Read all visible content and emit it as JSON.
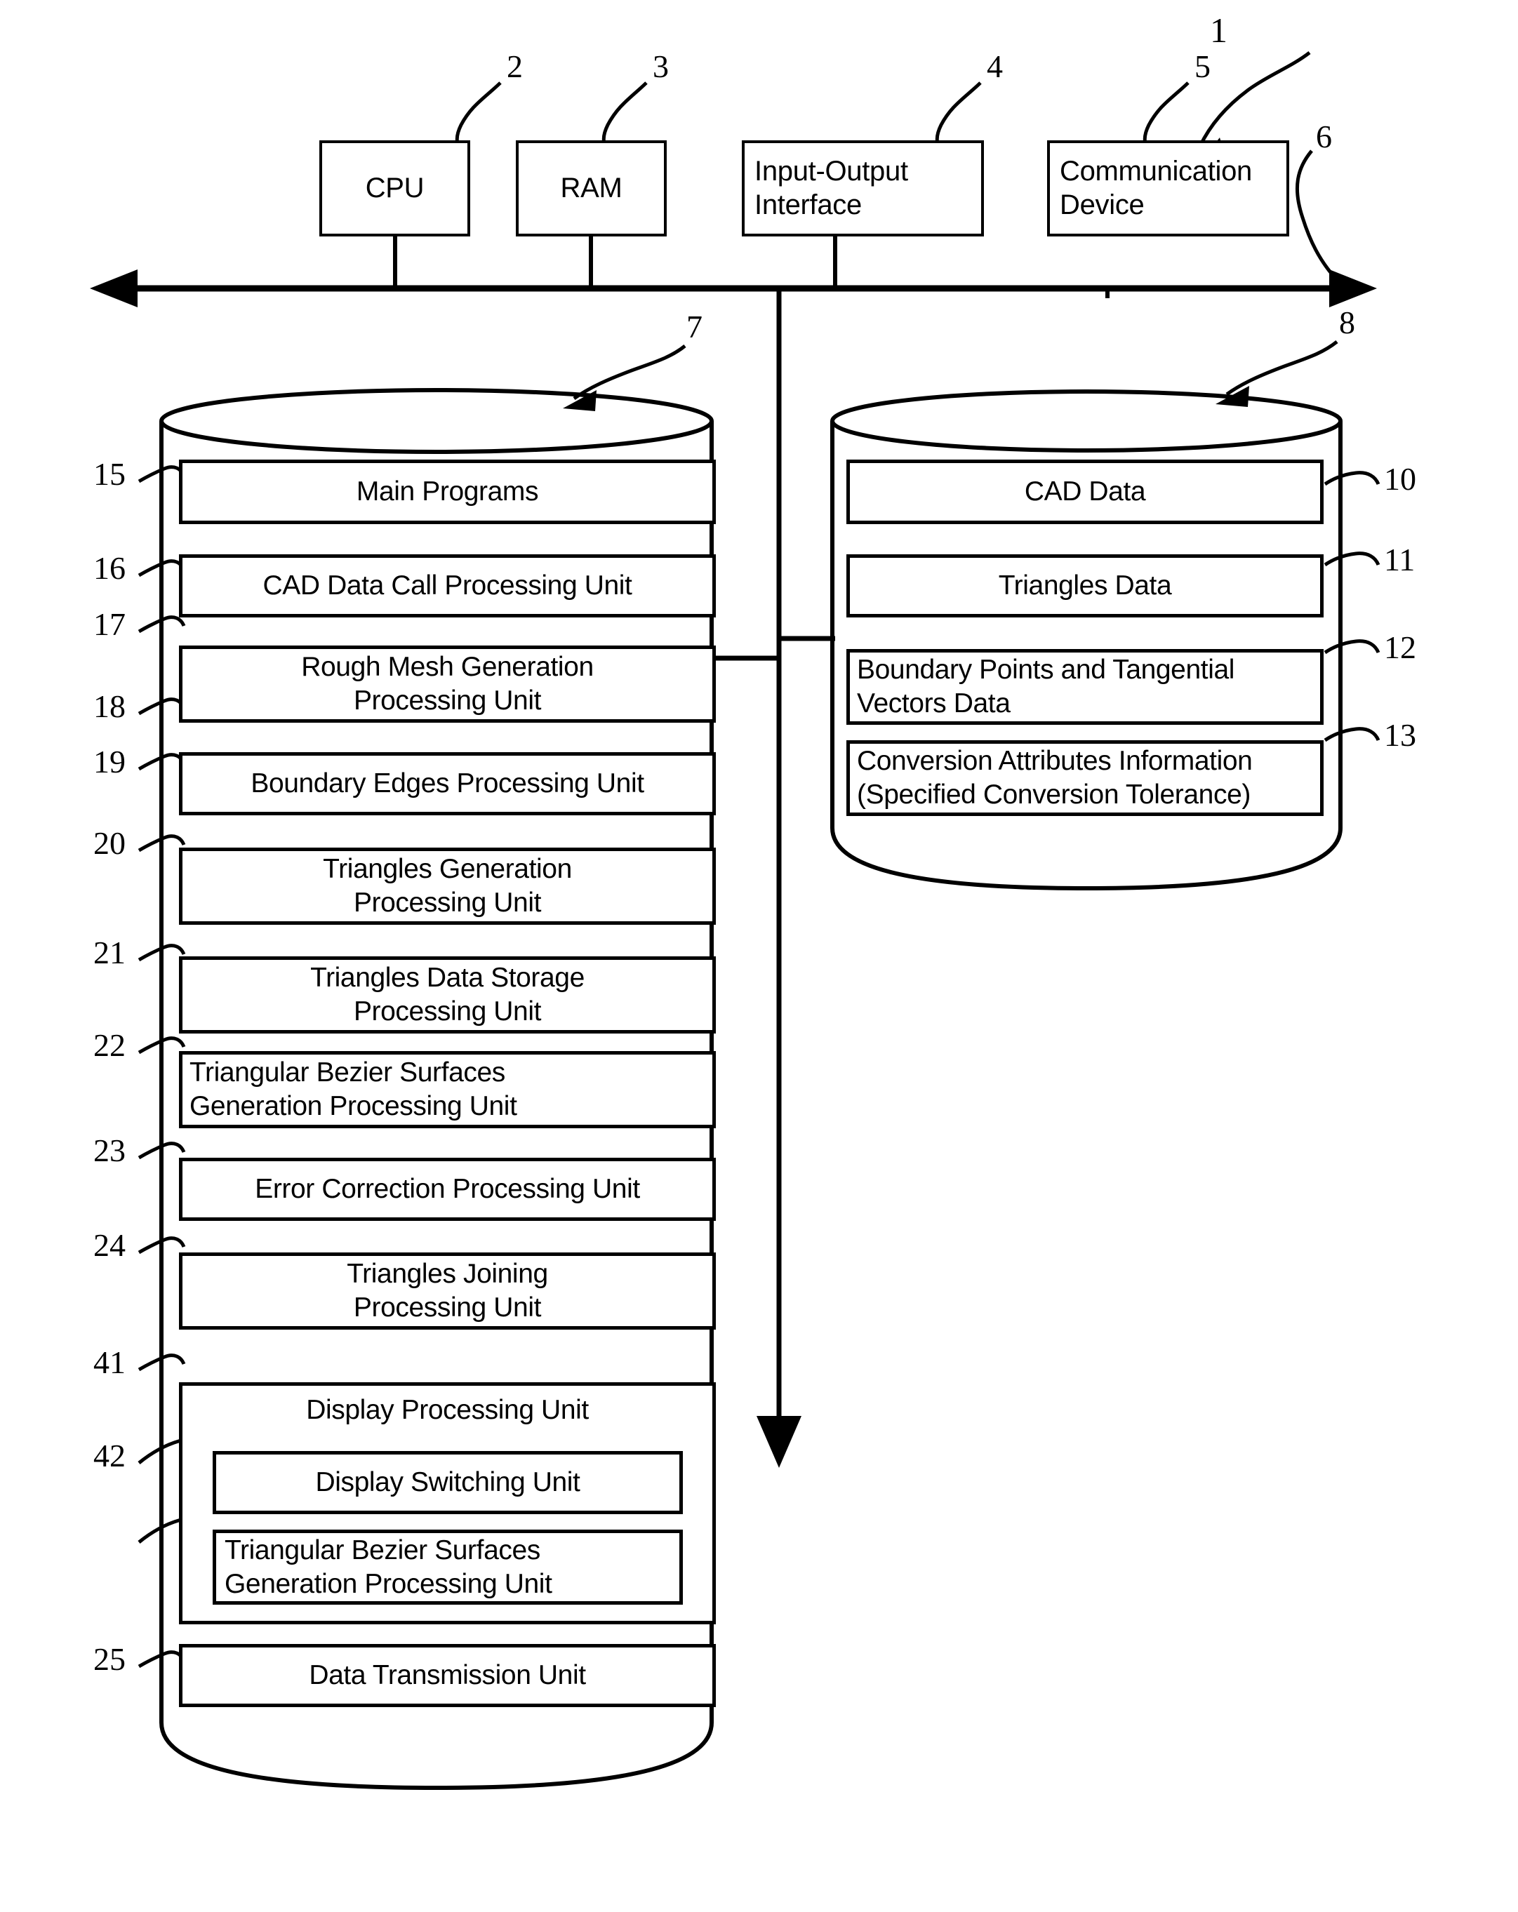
{
  "figure": {
    "type": "patent-block-diagram",
    "system_ref": "1",
    "bus_ref": "6",
    "program_storage_ref": "7",
    "data_storage_ref": "8"
  },
  "hardware": {
    "boxes": [
      {
        "ref": "2",
        "label": "CPU"
      },
      {
        "ref": "3",
        "label": "RAM"
      },
      {
        "ref": "4",
        "label_line1": "Input-Output",
        "label_line2": "Interface"
      },
      {
        "ref": "5",
        "label_line1": "Communication",
        "label_line2": "Device"
      }
    ]
  },
  "program_storage": {
    "ref": "7",
    "units": [
      {
        "ref": "15",
        "line1": "Main Programs",
        "line2": ""
      },
      {
        "ref": "16",
        "line1": "CAD Data Call Processing Unit",
        "line2": ""
      },
      {
        "ref": "17",
        "line1": "Rough Mesh Generation",
        "line2": "Processing Unit"
      },
      {
        "ref": "18",
        "line1": "Boundary Edges Processing Unit",
        "line2": ""
      },
      {
        "ref": "19",
        "line1": "Triangles Generation",
        "line2": "Processing Unit"
      },
      {
        "ref": "20",
        "line1": "Triangles Data Storage",
        "line2": "Processing Unit"
      },
      {
        "ref": "21",
        "line1": "Triangular Bezier Surfaces",
        "line2": "Generation Processing Unit"
      },
      {
        "ref": "22",
        "line1": "Error Correction Processing Unit",
        "line2": ""
      },
      {
        "ref": "23",
        "line1": "Triangles Joining",
        "line2": "Processing Unit"
      },
      {
        "ref": "24",
        "line1": "Display Processing Unit",
        "line2": ""
      },
      {
        "ref": "41",
        "line1": "Display Switching Unit",
        "line2": ""
      },
      {
        "ref": "42",
        "line1": "Triangular Bezier Surfaces",
        "line2": "Generation Processing Unit"
      },
      {
        "ref": "25",
        "line1": "Data Transmission Unit",
        "line2": ""
      }
    ]
  },
  "data_storage": {
    "ref": "8",
    "units": [
      {
        "ref": "10",
        "line1": "CAD Data",
        "line2": ""
      },
      {
        "ref": "11",
        "line1": "Triangles Data",
        "line2": ""
      },
      {
        "ref": "12",
        "line1": "Boundary Points and Tangential",
        "line2": "Vectors Data"
      },
      {
        "ref": "13",
        "line1": "Conversion Attributes Information",
        "line2": "(Specified Conversion Tolerance)"
      }
    ]
  },
  "colors": {
    "ink": "#000000",
    "paper": "#ffffff"
  }
}
